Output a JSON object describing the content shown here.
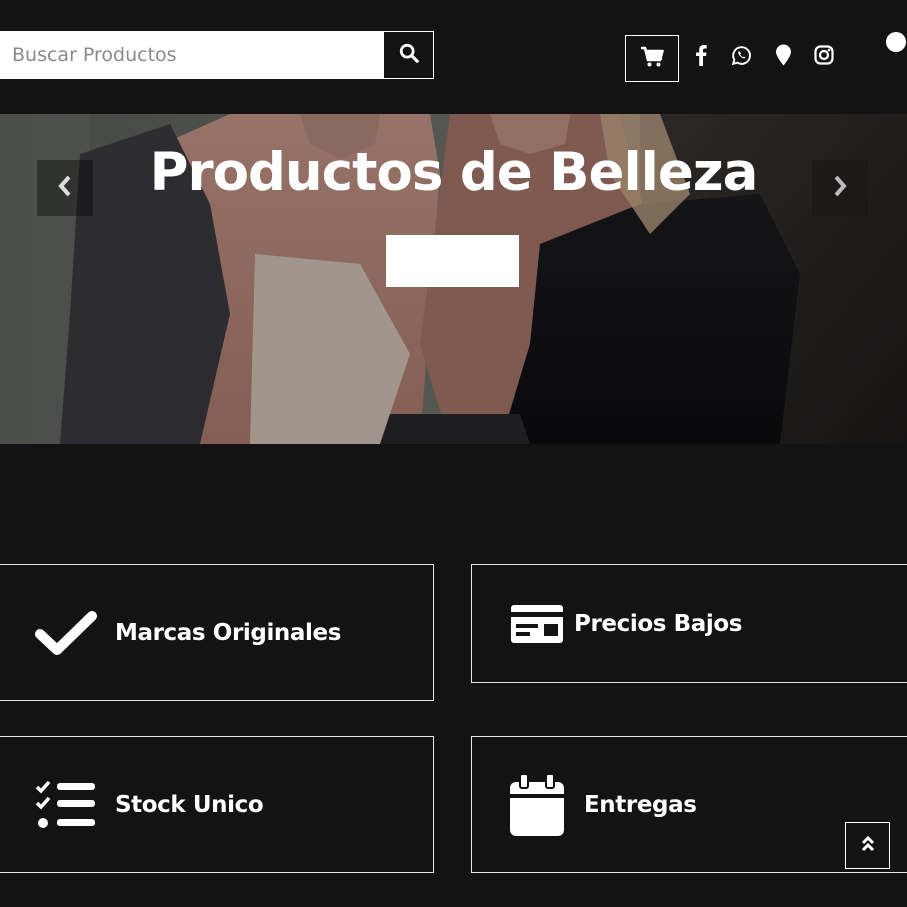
{
  "header": {
    "search": {
      "placeholder": "Buscar Productos",
      "value": ""
    },
    "icons": {
      "search": "search-icon",
      "cart": "cart-icon",
      "facebook": "facebook-icon",
      "whatsapp": "whatsapp-icon",
      "location": "map-pin-icon",
      "instagram": "instagram-icon"
    }
  },
  "hero": {
    "title": "Productos de Belleza",
    "cta_label": ""
  },
  "features": [
    {
      "label": "Marcas Originales",
      "icon": "checkmark-icon"
    },
    {
      "label": "Precios Bajos",
      "icon": "credit-card-icon"
    },
    {
      "label": "Stock Unico",
      "icon": "checklist-icon"
    },
    {
      "label": "Entregas",
      "icon": "calendar-icon"
    }
  ],
  "colors": {
    "background": "#131313",
    "text": "#ffffff",
    "border": "#e6e6e6"
  }
}
